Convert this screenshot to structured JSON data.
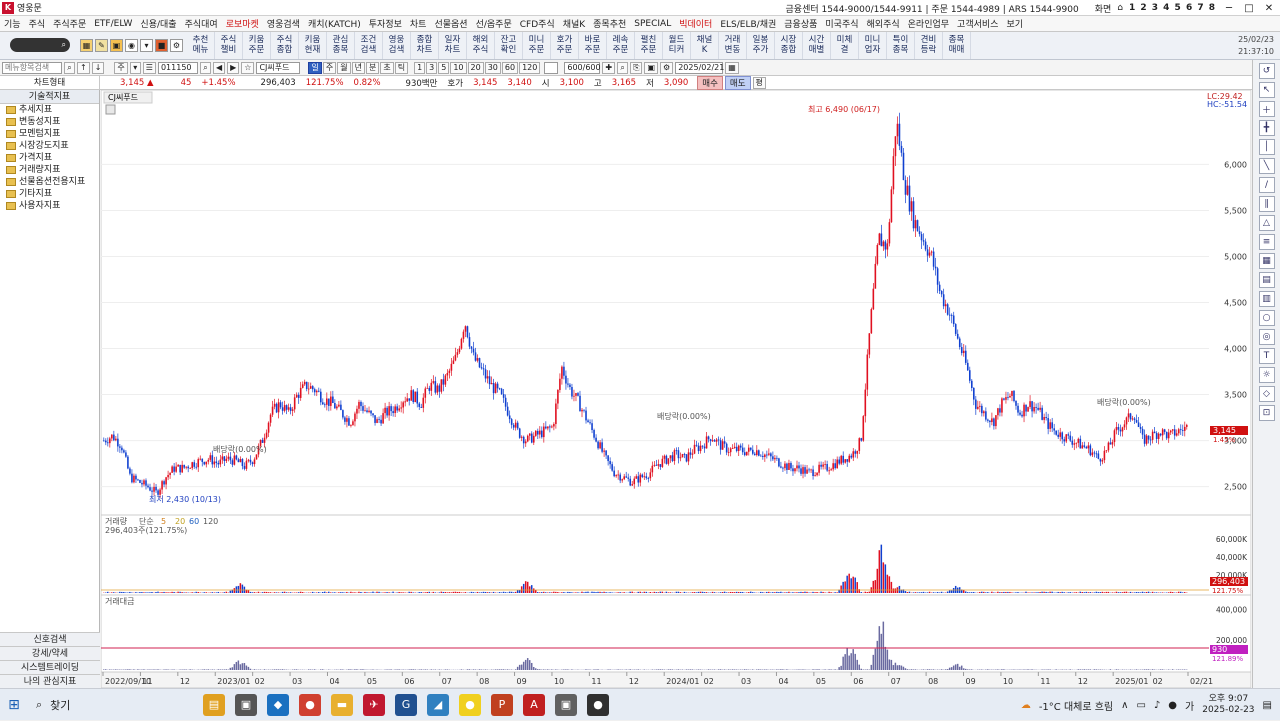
{
  "window": {
    "title": "영웅문",
    "center_info": "금융센터 1544-9000/1544-9911  |  주문 1544-4989  |  ARS 1544-9900",
    "right_label": "화면",
    "screen_numbers": "1 2 3 4 5 6 7 8"
  },
  "menu": [
    "기능",
    "주식",
    "주식주문",
    "ETF/ELW",
    "신용/대출",
    "주식대여",
    "로보마켓",
    "영웅검색",
    "캐치(KATCH)",
    "투자정보",
    "차트",
    "선물옵션",
    "선/옵주문",
    "CFD주식",
    "채널K",
    "종목추천",
    "SPECIAL",
    "빅데이터",
    "ELS/ELB/채권",
    "금융상품",
    "미국주식",
    "해외주식",
    "온라인업무",
    "고객서비스",
    "보기"
  ],
  "menu_red": [
    "로보마켓",
    "빅데이터"
  ],
  "toolbar": {
    "buttons": [
      "추천\n메뉴",
      "주식\n챌비",
      "키움\n주문",
      "주식\n종합",
      "키움\n현재",
      "관심\n종목",
      "조건\n검색",
      "영웅\n검색",
      "종합\n차트",
      "일자\n차트",
      "해외\n주식",
      "잔고\n확인",
      "미니\n주문",
      "호가\n주문",
      "바로\n주문",
      "례속\n주문",
      "펼친\n주문",
      "월드\n티커",
      "채널\nK",
      "거래\n변동",
      "일봉\n주가",
      "시장\n종합",
      "시간\n매별",
      "미체\n결",
      "미니\n업자",
      "특이\n종목",
      "견비\n등락",
      "종목\n매매"
    ],
    "date": "25/02/23",
    "time": "21:37:10"
  },
  "chartbar": {
    "menu_search": "메뉴항목검색",
    "period_type": "주",
    "code": "011150",
    "stock_name": "CJ씨푸드",
    "periods": [
      "일",
      "주",
      "월",
      "년",
      "분",
      "초",
      "틱"
    ],
    "active_period": "일",
    "intervals": [
      "1",
      "3",
      "5",
      "10",
      "20",
      "30",
      "60",
      "120"
    ],
    "count": "600/600",
    "date": "2025/02/21"
  },
  "pricebar": {
    "left_label": "차트형태",
    "price": "3,145",
    "change": "45",
    "change_pct": "+1.45%",
    "volume": "296,403",
    "vol_pct": "121.75%",
    "turnover": "0.82%",
    "amount": "930백만",
    "hoga_label": "호가",
    "ask": "3,145",
    "bid": "3,140",
    "open_label": "시",
    "open": "3,100",
    "high_label": "고",
    "high": "3,165",
    "low_label": "저",
    "low": "3,090",
    "sell": "매수",
    "buy": "매도",
    "flat": "평"
  },
  "left_panel": {
    "header": "기술적지표",
    "items": [
      "추세지표",
      "변동성지표",
      "모멘텀지표",
      "시장강도지표",
      "가격지표",
      "거래량지표",
      "선물옵션전용지표",
      "기타지표",
      "사용자지표"
    ],
    "bottom": [
      "신호검색",
      "강세/약세",
      "시스템트레이딩",
      "나의 관심지표"
    ]
  },
  "chart": {
    "stock_label": "CJ씨푸드",
    "lc": "LC:29.42",
    "hc": "HC:-51.54",
    "price_axis": [
      "6,000",
      "5,500",
      "5,000",
      "4,500",
      "4,000",
      "3,500",
      "3,000",
      "2,500"
    ],
    "current_price_tag": "3,145",
    "current_pct_tag": "1.45%",
    "annotations": {
      "high": "최고 6,490 (06/17)",
      "low": "최저 2,430 (10/13)",
      "ex_div_1": "배당락(0.00%)",
      "ex_div_2": "배당락(0.00%)",
      "ex_div_3": "배당락(0.00%)"
    },
    "volume_label": "거래량",
    "volume_ma": [
      "단순",
      "5",
      "20",
      "60",
      "120"
    ],
    "volume_value": "296,403주(121.75%)",
    "volume_axis": [
      "60,000K",
      "40,000K",
      "20,000K"
    ],
    "volume_tag": "296,403",
    "volume_tag_pct": "121.75%",
    "amount_label": "거래대금",
    "amount_axis": [
      "400,000",
      "200,000"
    ],
    "amount_tag": "930",
    "amount_tag_pct": "121.89%",
    "x_axis": [
      "2022/09/10",
      "11",
      "12",
      "2023/01",
      "02",
      "03",
      "04",
      "05",
      "06",
      "07",
      "08",
      "09",
      "10",
      "11",
      "12",
      "2024/01",
      "02",
      "03",
      "04",
      "05",
      "06",
      "07",
      "08",
      "09",
      "10",
      "11",
      "12",
      "2025/01",
      "02",
      "02/21"
    ]
  },
  "chart_data": {
    "type": "candlestick",
    "title": "",
    "ylim": [
      2300,
      6700
    ],
    "price_path": [
      3000,
      3050,
      2950,
      2600,
      2550,
      2500,
      2430,
      2600,
      2700,
      2700,
      2750,
      2780,
      2800,
      2750,
      2800,
      2780,
      2720,
      2800,
      3000,
      3300,
      3400,
      3300,
      3500,
      3600,
      3550,
      3450,
      3400,
      3300,
      3200,
      3400,
      3300,
      3200,
      3300,
      3350,
      3450,
      3500,
      3400,
      3600,
      3550,
      3700,
      3900,
      4300,
      3900,
      3750,
      3600,
      3500,
      3300,
      3100,
      3000,
      3050,
      3100,
      3150,
      3800,
      3550,
      3400,
      3200,
      3000,
      2800,
      2650,
      2600,
      2550,
      2600,
      2650,
      2750,
      2800,
      2850,
      2800,
      2900,
      2950,
      3050,
      2950,
      2900,
      2900,
      2880,
      2900,
      2850,
      2800,
      2750,
      2700,
      2700,
      2650,
      2680,
      2700,
      2750,
      2800,
      2850,
      3000,
      4200,
      5200,
      5100,
      6490,
      5800,
      5400,
      5200,
      5000,
      4600,
      4400,
      4100,
      3800,
      3400,
      3300,
      3200,
      3400,
      3500,
      3300,
      3400,
      3350,
      3200,
      3100,
      3050,
      3000,
      2950,
      2900,
      2800,
      2900,
      3100,
      3200,
      3300,
      3000,
      3050,
      3100,
      3050,
      3100,
      3145
    ],
    "volume_spikes": [
      {
        "x": "2023/01",
        "value": 12000
      },
      {
        "x": "2023/08",
        "value": 14000
      },
      {
        "x": "2024/05",
        "value": 30000
      },
      {
        "x": "2024/06",
        "value": 60000
      },
      {
        "x": "2024/07",
        "value": 10000
      },
      {
        "x": "2024/08",
        "value": 8000
      }
    ]
  },
  "right_tools": [
    "↺",
    "↖",
    "＋",
    "╋",
    "│",
    "╲",
    "∕",
    "∥",
    "△",
    "≡",
    "▦",
    "▤",
    "▥",
    "○",
    "◎",
    "T",
    "☼",
    "◇",
    "⊡"
  ],
  "taskbar": {
    "search_label": "찾기",
    "weather": "-1°C 대체로 흐림",
    "ime": "가",
    "time": "오후 9:07",
    "date": "2025-02-23"
  },
  "taskbar_apps": [
    {
      "name": "file-explorer",
      "color": "#e0a020",
      "glyph": "▤"
    },
    {
      "name": "task-view",
      "color": "#555555",
      "glyph": "▣"
    },
    {
      "name": "store",
      "color": "#1a70c0",
      "glyph": "◆"
    },
    {
      "name": "chrome",
      "color": "#d04030",
      "glyph": "●"
    },
    {
      "name": "folder",
      "color": "#e8b030",
      "glyph": "▬"
    },
    {
      "name": "hero-app",
      "color": "#c01830",
      "glyph": "✈"
    },
    {
      "name": "g-app",
      "color": "#205090",
      "glyph": "G"
    },
    {
      "name": "blue-app",
      "color": "#3080c0",
      "glyph": "◢"
    },
    {
      "name": "kakao",
      "color": "#f0d020",
      "glyph": "●"
    },
    {
      "name": "powerpoint",
      "color": "#c04020",
      "glyph": "P"
    },
    {
      "name": "acrobat",
      "color": "#c02020",
      "glyph": "A"
    },
    {
      "name": "photo",
      "color": "#606060",
      "glyph": "▣"
    },
    {
      "name": "rec",
      "color": "#303030",
      "glyph": "●"
    }
  ]
}
